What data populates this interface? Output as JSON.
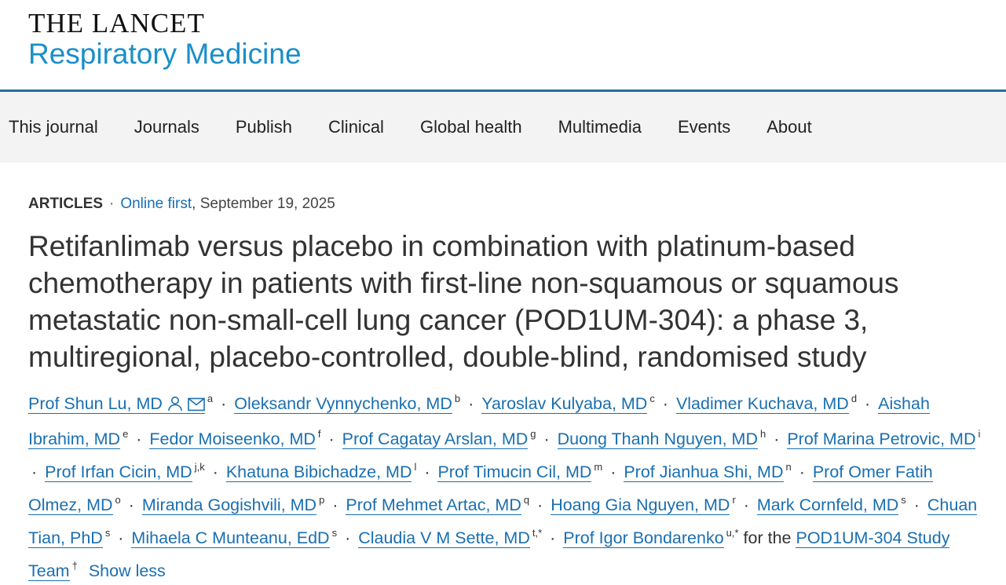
{
  "brand": {
    "line1": "THE LANCET",
    "line2": "Respiratory Medicine"
  },
  "nav": [
    "This journal",
    "Journals",
    "Publish",
    "Clinical",
    "Global health",
    "Multimedia",
    "Events",
    "About"
  ],
  "article": {
    "type": "ARTICLES",
    "status": "Online first",
    "date": ", September 19, 2025",
    "title": "Retifanlimab versus placebo in combination with platinum-based chemotherapy in patients with first-line non-squamous or squamous metastatic non-small-cell lung cancer (POD1UM-304): a phase 3, multiregional, placebo-controlled, double-blind, randomised study"
  },
  "authors": [
    {
      "name": "Prof Shun Lu, MD",
      "sup": "a",
      "icons": [
        "person-icon",
        "email-icon"
      ]
    },
    {
      "name": "Oleksandr Vynnychenko, MD",
      "sup": "b"
    },
    {
      "name": "Yaroslav Kulyaba, MD",
      "sup": "c"
    },
    {
      "name": "Vladimer Kuchava, MD",
      "sup": "d"
    },
    {
      "name": "Aishah Ibrahim, MD",
      "sup": "e"
    },
    {
      "name": "Fedor Moiseenko, MD",
      "sup": "f"
    },
    {
      "name": "Prof Cagatay Arslan, MD",
      "sup": "g"
    },
    {
      "name": "Duong Thanh Nguyen, MD",
      "sup": "h"
    },
    {
      "name": "Prof Marina Petrovic, MD",
      "sup": "i"
    },
    {
      "name": "Prof Irfan Cicin, MD",
      "sup": "j,k"
    },
    {
      "name": "Khatuna Bibichadze, MD",
      "sup": "l"
    },
    {
      "name": "Prof Timucin Cil, MD",
      "sup": "m"
    },
    {
      "name": "Prof Jianhua Shi, MD",
      "sup": "n"
    },
    {
      "name": "Prof Omer Fatih Olmez, MD",
      "sup": "o"
    },
    {
      "name": "Miranda Gogishvili, MD",
      "sup": "p"
    },
    {
      "name": "Prof Mehmet Artac, MD",
      "sup": "q"
    },
    {
      "name": "Hoang Gia Nguyen, MD",
      "sup": "r"
    },
    {
      "name": "Mark Cornfeld, MD",
      "sup": "s"
    },
    {
      "name": "Chuan Tian, PhD",
      "sup": "s"
    },
    {
      "name": "Mihaela C Munteanu, EdD",
      "sup": "s"
    },
    {
      "name": "Claudia V M Sette, MD",
      "sup": "t,*"
    },
    {
      "name": "Prof Igor Bondarenko",
      "sup": "u,*"
    }
  ],
  "team": {
    "prefix": "for the",
    "name": "POD1UM-304 Study Team",
    "sup": "†"
  },
  "show_less": "Show less",
  "colors": {
    "link": "#1a6fb0",
    "brand_blue": "#1a8fc9",
    "rule": "#1e6fa0",
    "nav_bg": "#f3f3f3"
  }
}
